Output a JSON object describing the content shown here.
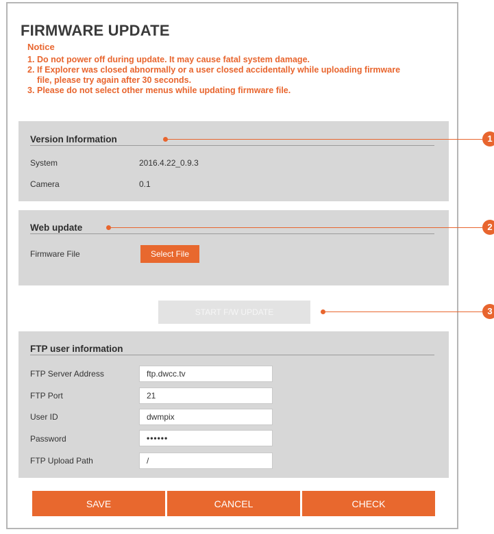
{
  "page_title": "FIRMWARE UPDATE",
  "notice": {
    "title": "Notice",
    "items": [
      {
        "num": "1.",
        "text": "Do not power off during update. It may cause fatal system damage."
      },
      {
        "num": "2.",
        "text": "If Explorer was closed abnormally or a user closed accidentally while uploading firmware file, please try again after 30 seconds."
      },
      {
        "num": "3.",
        "text": "Please do not select other menus while updating firmware file."
      }
    ]
  },
  "version_info": {
    "title": "Version Information",
    "rows": [
      {
        "label": "System",
        "value": "2016.4.22_0.9.3"
      },
      {
        "label": "Camera",
        "value": "0.1"
      }
    ]
  },
  "web_update": {
    "title": "Web update",
    "firmware_label": "Firmware File",
    "select_file_label": "Select File"
  },
  "start_button_label": "START F/W UPDATE",
  "ftp": {
    "title": "FTP user information",
    "fields": [
      {
        "label": "FTP Server Address",
        "value": "ftp.dwcc.tv"
      },
      {
        "label": "FTP Port",
        "value": "21"
      },
      {
        "label": "User ID",
        "value": "dwmpix"
      },
      {
        "label": "Password",
        "value": "••••••"
      },
      {
        "label": "FTP Upload Path",
        "value": "/"
      }
    ]
  },
  "buttons": {
    "save": "SAVE",
    "cancel": "CANCEL",
    "check": "CHECK"
  },
  "callouts": [
    "1",
    "2",
    "3"
  ],
  "colors": {
    "accent": "#e8652e",
    "panel": "#d7d7d7",
    "disabled_button": "#e3e3e3"
  }
}
